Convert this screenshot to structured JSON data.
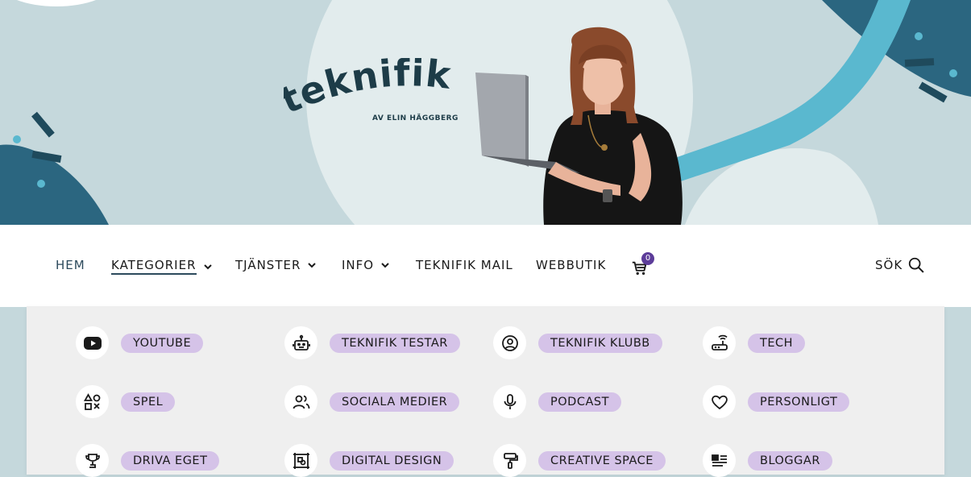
{
  "hero": {
    "logo_word": "teknifik",
    "logo_sub": "AV ELIN HÄGGBERG"
  },
  "nav": {
    "items": [
      {
        "label": "HEM"
      },
      {
        "label": "KATEGORIER"
      },
      {
        "label": "TJÄNSTER"
      },
      {
        "label": "INFO"
      },
      {
        "label": "TEKNIFIK MAIL"
      },
      {
        "label": "WEBBUTIK"
      }
    ],
    "cart_count": "0",
    "search_label": "SÖK"
  },
  "categories": [
    {
      "label": "YOUTUBE",
      "icon": "youtube-icon"
    },
    {
      "label": "TEKNIFIK TESTAR",
      "icon": "robot-icon"
    },
    {
      "label": "TEKNIFIK KLUBB",
      "icon": "user-circle-icon"
    },
    {
      "label": "TECH",
      "icon": "router-icon"
    },
    {
      "label": "SPEL",
      "icon": "shapes-icon"
    },
    {
      "label": "SOCIALA MEDIER",
      "icon": "users-icon"
    },
    {
      "label": "PODCAST",
      "icon": "microphone-icon"
    },
    {
      "label": "PERSONLIGT",
      "icon": "heart-icon"
    },
    {
      "label": "DRIVA EGET",
      "icon": "trophy-icon"
    },
    {
      "label": "DIGITAL DESIGN",
      "icon": "frame-icon"
    },
    {
      "label": "CREATIVE SPACE",
      "icon": "paint-roller-icon"
    },
    {
      "label": "BLOGGAR",
      "icon": "article-icon"
    }
  ],
  "colors": {
    "hero_bg": "#c5d8dc",
    "dark_teal": "#2b6680",
    "light_blue": "#5ab8cf",
    "pill": "#d5c3e8",
    "badge": "#5c3c99",
    "panel": "#efefef"
  }
}
